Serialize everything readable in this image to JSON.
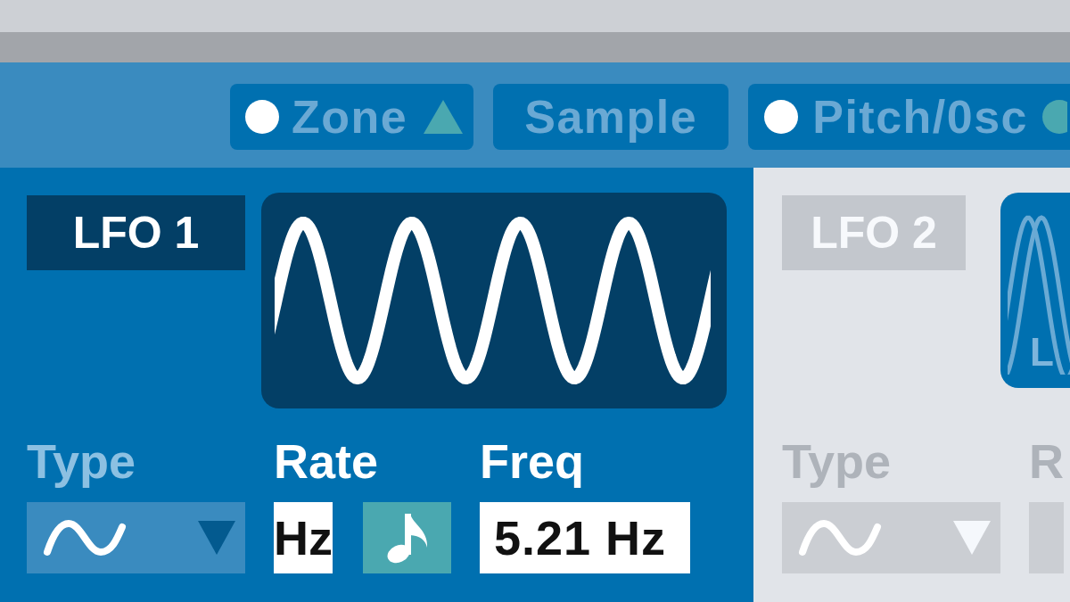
{
  "tabs": [
    {
      "label": "Zone",
      "kind": "expander",
      "led_on": true
    },
    {
      "label": "Sample",
      "kind": "plain",
      "led_on": false
    },
    {
      "label": "Pitch/0sc",
      "kind": "indicator",
      "led_on": true
    }
  ],
  "lfo_panels": [
    {
      "title": "LFO 1",
      "enabled": true,
      "display": {
        "kind": "single"
      },
      "controls": [
        {
          "kind": "dropdown",
          "label": "Type",
          "label_dimmed": true
        },
        {
          "kind": "rate",
          "label": "Rate",
          "label_dimmed": false,
          "unit": "Hz",
          "sync_button": true
        },
        {
          "kind": "number",
          "label": "Freq",
          "label_dimmed": false,
          "value": "5.21 Hz"
        }
      ]
    },
    {
      "title": "LFO 2",
      "enabled": false,
      "display": {
        "kind": "stereo",
        "channel_label": "L"
      },
      "controls": [
        {
          "kind": "dropdown",
          "label": "Type",
          "label_dimmed": false
        },
        {
          "kind": "rate",
          "label": "R",
          "label_dimmed": false
        }
      ]
    }
  ]
}
